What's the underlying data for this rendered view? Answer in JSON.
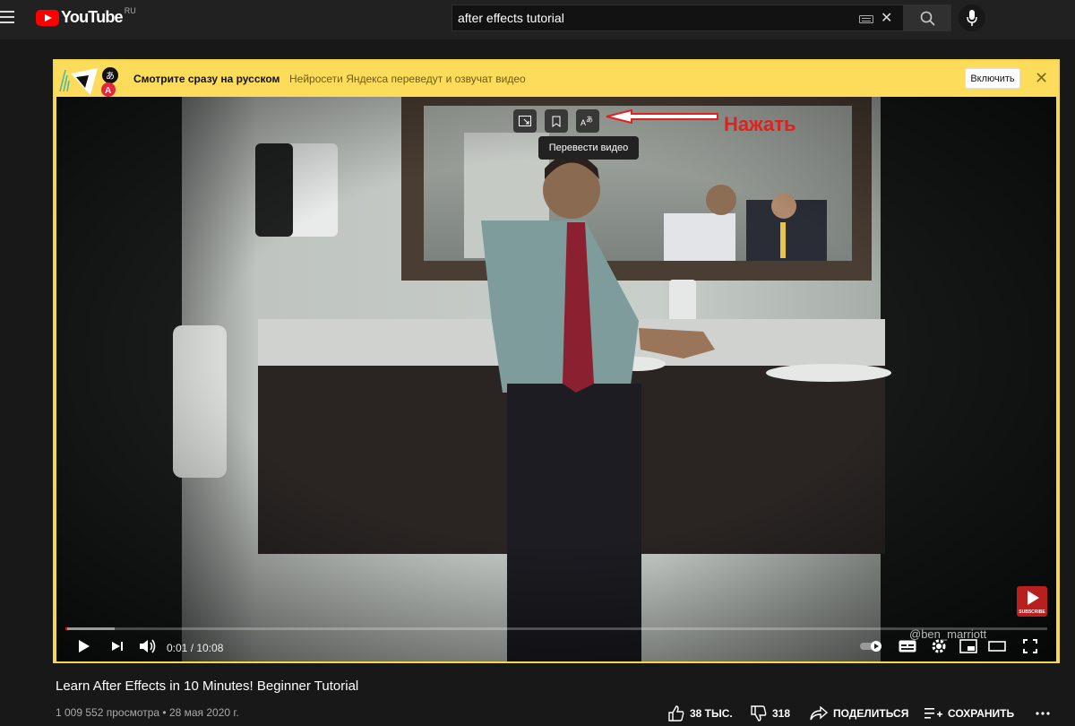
{
  "header": {
    "logo_text": "YouTube",
    "region": "RU",
    "search_value": "after effects tutorial"
  },
  "yandex": {
    "title": "Смотрите сразу на русском",
    "subtitle": "Нейросети Яндекса переведут и озвучат видео",
    "enable_label": "Включить",
    "tooltip": "Перевести видео",
    "annotation": "Нажать"
  },
  "player": {
    "time": "0:01 / 10:08",
    "progress_played": 0.002,
    "progress_loaded": 0.05,
    "subscribe_label": "SUBSCRIBE",
    "watermark": "@ben_marriott",
    "accent_color": "#ff0000"
  },
  "video": {
    "title": "Learn After Effects in 10 Minutes! Beginner Tutorial",
    "meta": "1 009 552 просмотра • 28 мая 2020 г.",
    "likes": "38 ТЫС.",
    "dislikes": "318",
    "share_label": "ПОДЕЛИТЬСЯ",
    "save_label": "СОХРАНИТЬ"
  }
}
